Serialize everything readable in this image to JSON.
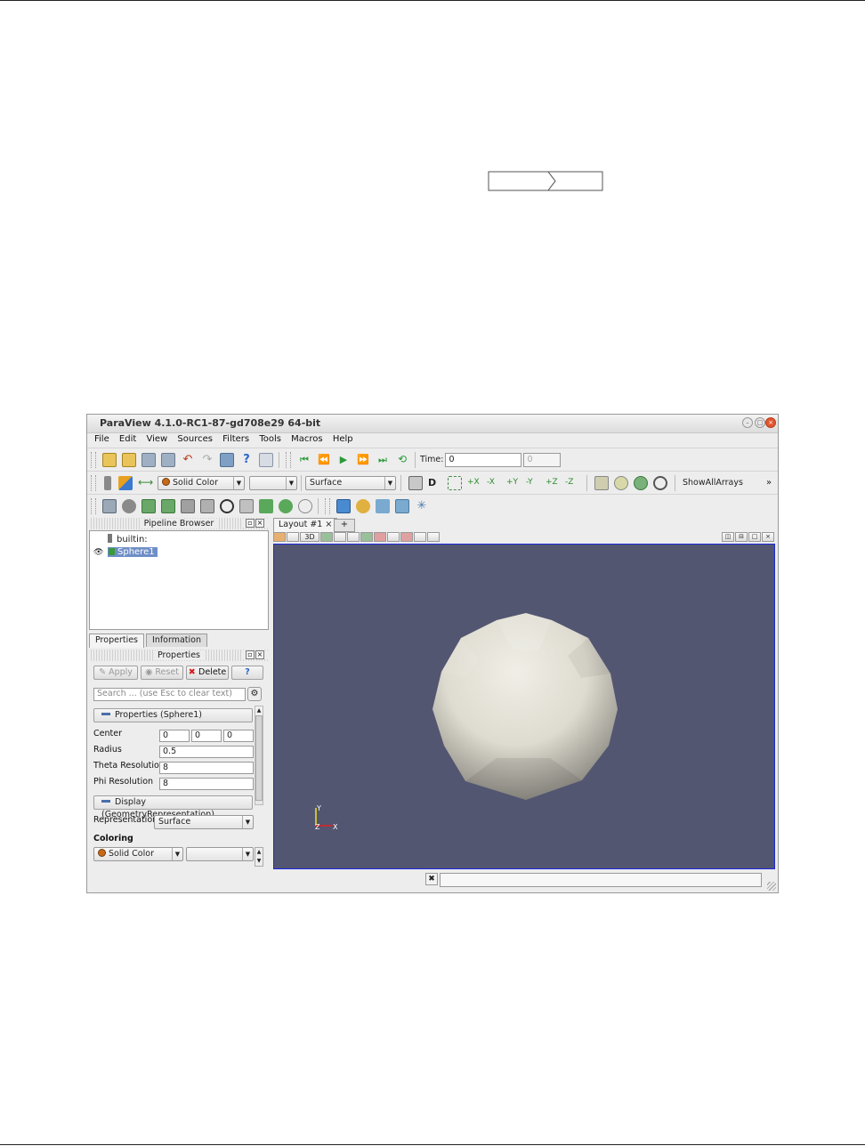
{
  "app": {
    "title": "ParaView 4.1.0-RC1-87-gd708e29 64-bit",
    "window_buttons": [
      "–",
      "□",
      "×"
    ]
  },
  "menu": [
    "File",
    "Edit",
    "View",
    "Sources",
    "Filters",
    "Tools",
    "Macros",
    "Help"
  ],
  "toolbar": {
    "time_label": "Time:",
    "time_value": "0",
    "time_step": "0",
    "color_by": "Solid Color",
    "color_component": "",
    "representation": "Surface",
    "show_all_arrays": "ShowAllArrays",
    "more": "»"
  },
  "pipeline": {
    "header": "Pipeline Browser",
    "items": [
      {
        "label": "builtin:"
      },
      {
        "label": "Sphere1",
        "selected": true
      }
    ]
  },
  "tabs": [
    "Properties",
    "Information"
  ],
  "properties": {
    "header": "Properties",
    "apply": "Apply",
    "reset": "Reset",
    "delete": "Delete",
    "help": "?",
    "search_placeholder": "Search ... (use Esc to clear text)",
    "section_props": "Properties (Sphere1)",
    "center_label": "Center",
    "center": [
      "0",
      "0",
      "0"
    ],
    "radius_label": "Radius",
    "radius": "0.5",
    "theta_label": "Theta Resolution",
    "theta": "8",
    "phi_label": "Phi Resolution",
    "phi": "8",
    "section_display": "Display (GeometryRepresentation)",
    "representation_label": "Representation",
    "representation": "Surface",
    "coloring_label": "Coloring",
    "coloring": "Solid Color",
    "coloring_component": ""
  },
  "layout": {
    "tab": "Layout #1",
    "plus": "+",
    "mode_3d": "3D",
    "axes": {
      "y": "Y",
      "z": "Z",
      "x": "X"
    }
  },
  "colors": {
    "background": "#525671",
    "viewport_border": "#1c28e0",
    "selection": "#6f8ec8",
    "solid_color": "#c46a1a"
  }
}
